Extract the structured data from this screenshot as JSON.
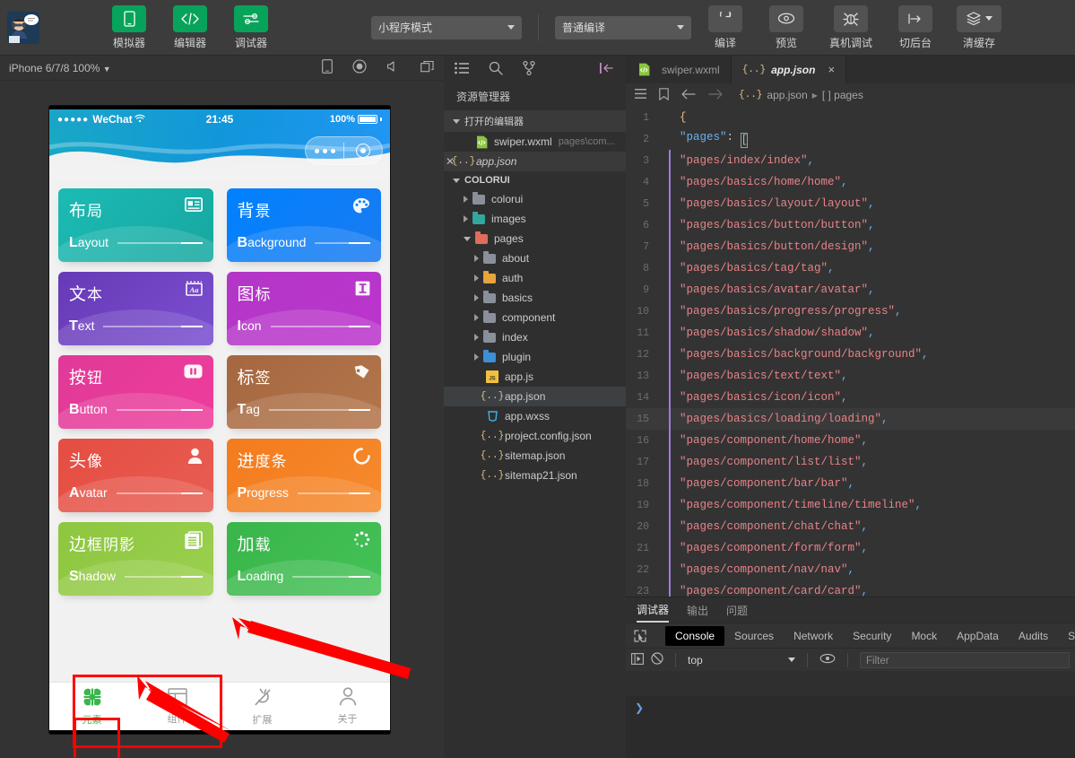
{
  "toolbar": {
    "avatar_name": "user-avatar",
    "buttons": [
      {
        "label": "模拟器",
        "icon": "phone-icon",
        "style": "green"
      },
      {
        "label": "编辑器",
        "icon": "code-icon",
        "style": "green"
      },
      {
        "label": "调试器",
        "icon": "sliders-icon",
        "style": "green"
      }
    ],
    "mode_select": "小程序模式",
    "compile_select": "普通编译",
    "actions": [
      {
        "label": "编译",
        "icon": "refresh-icon"
      },
      {
        "label": "预览",
        "icon": "eye-icon"
      },
      {
        "label": "真机调试",
        "icon": "bug-icon"
      },
      {
        "label": "切后台",
        "icon": "background-icon"
      },
      {
        "label": "清缓存",
        "icon": "layers-icon"
      }
    ]
  },
  "simulator": {
    "device": "iPhone 6/7/8 100%",
    "bar_icons": [
      "rotate-icon",
      "record-icon",
      "sound-icon",
      "windows-icon"
    ],
    "status": {
      "carrier": "WeChat",
      "dots": "●●●●●",
      "time": "21:45",
      "battery": "100%"
    },
    "cards": [
      {
        "cn": "布局",
        "cn_first": "布",
        "en": "Layout",
        "en_first": "L",
        "icon": "id-card-icon",
        "c1": "#1cbbb4",
        "c2": "#16a7a0"
      },
      {
        "cn": "背景",
        "cn_first": "背",
        "en": "Background",
        "en_first": "B",
        "icon": "palette-icon",
        "c1": "#0081ff",
        "c2": "#1a7bf0"
      },
      {
        "cn": "文本",
        "cn_first": "文",
        "en": "Text",
        "en_first": "T",
        "icon": "aa-icon",
        "c1": "#6739b6",
        "c2": "#7a4fd0"
      },
      {
        "cn": "图标",
        "cn_first": "图",
        "en": "Icon",
        "en_first": "I",
        "icon": "letter-i-icon",
        "c1": "#b336c7",
        "c2": "#bb35cc"
      },
      {
        "cn": "按钮",
        "cn_first": "按",
        "en": "Button",
        "en_first": "B",
        "icon": "pause-icon",
        "c1": "#e03997",
        "c2": "#ef3d9c"
      },
      {
        "cn": "标签",
        "cn_first": "标",
        "en": "Tag",
        "en_first": "T",
        "icon": "tag-icon",
        "c1": "#a5673f",
        "c2": "#b3764c"
      },
      {
        "cn": "头像",
        "cn_first": "头",
        "en": "Avatar",
        "en_first": "A",
        "icon": "person-icon",
        "c1": "#e54d42",
        "c2": "#e85d52"
      },
      {
        "cn": "进度条",
        "cn_first": "进",
        "en": "Progress",
        "en_first": "P",
        "icon": "spinner-icon",
        "c1": "#f37b1d",
        "c2": "#f68b2e"
      },
      {
        "cn": "边框阴影",
        "cn_first": "边",
        "en": "Shadow",
        "en_first": "S",
        "icon": "pages-icon",
        "c1": "#8dc63f",
        "c2": "#9bd04f"
      },
      {
        "cn": "加载",
        "cn_first": "加",
        "en": "Loading",
        "en_first": "L",
        "icon": "loading-icon",
        "c1": "#39b54a",
        "c2": "#45c257"
      }
    ],
    "tabbar": [
      {
        "label": "元素",
        "icon": "flower-icon",
        "active": true
      },
      {
        "label": "组件",
        "icon": "layout-icon",
        "active": false
      },
      {
        "label": "扩展",
        "icon": "plug-icon",
        "active": false
      },
      {
        "label": "关于",
        "icon": "person-icon",
        "active": false
      }
    ]
  },
  "explorer": {
    "top_icons": [
      "files-icon",
      "search-icon",
      "source-control-icon"
    ],
    "collapse_icon": "collapse-panel-icon",
    "title": "资源管理器",
    "open_editors_label": "打开的编辑器",
    "open_editors": [
      {
        "name": "swiper.wxml",
        "path": "pages\\com...",
        "icon": "wxml-file-icon"
      },
      {
        "name": "app.json",
        "path": "",
        "icon": "json-file-icon",
        "active": true
      }
    ],
    "project_label": "COLORUI",
    "tree": [
      {
        "name": "colorui",
        "type": "folder",
        "depth": 1,
        "color": "grey",
        "arrow": true
      },
      {
        "name": "images",
        "type": "folder",
        "depth": 1,
        "color": "teal",
        "arrow": true
      },
      {
        "name": "pages",
        "type": "folder",
        "depth": 1,
        "color": "red",
        "arrow": true,
        "open": true
      },
      {
        "name": "about",
        "type": "folder",
        "depth": 2,
        "color": "grey",
        "arrow": true
      },
      {
        "name": "auth",
        "type": "folder",
        "depth": 2,
        "color": "orange",
        "arrow": true
      },
      {
        "name": "basics",
        "type": "folder",
        "depth": 2,
        "color": "grey",
        "arrow": true
      },
      {
        "name": "component",
        "type": "folder",
        "depth": 2,
        "color": "grey",
        "arrow": true
      },
      {
        "name": "index",
        "type": "folder",
        "depth": 2,
        "color": "grey",
        "arrow": true
      },
      {
        "name": "plugin",
        "type": "folder",
        "depth": 2,
        "color": "blue",
        "arrow": true
      },
      {
        "name": "app.js",
        "type": "js",
        "depth": 2
      },
      {
        "name": "app.json",
        "type": "json",
        "depth": 2,
        "selected": true
      },
      {
        "name": "app.wxss",
        "type": "wxss",
        "depth": 2
      },
      {
        "name": "project.config.json",
        "type": "json",
        "depth": 2
      },
      {
        "name": "sitemap.json",
        "type": "json",
        "depth": 2
      },
      {
        "name": "sitemap21.json",
        "type": "json",
        "depth": 2
      }
    ]
  },
  "editor": {
    "tabs": [
      {
        "label": "swiper.wxml",
        "icon": "wxml-file-icon",
        "active": false
      },
      {
        "label": "app.json",
        "icon": "json-file-icon",
        "active": true,
        "close": "×"
      }
    ],
    "breadcrumb_icons": [
      "outline-icon",
      "bookmark-icon",
      "back-arrow-icon",
      "forward-arrow-icon"
    ],
    "breadcrumb": "app.json ▸ [ ] pages",
    "breadcrumb_file": "app.json",
    "breadcrumb_sep": "▸",
    "breadcrumb_node": "[ ] pages",
    "lines": [
      {
        "n": 1,
        "text": "{",
        "kind": "brace",
        "guide": false
      },
      {
        "n": 2,
        "text": "\"pages\": [",
        "kind": "keyline",
        "guide": false
      },
      {
        "n": 3,
        "text": "\"pages/index/index\",",
        "kind": "str",
        "guide": true
      },
      {
        "n": 4,
        "text": "\"pages/basics/home/home\",",
        "kind": "str",
        "guide": true
      },
      {
        "n": 5,
        "text": "\"pages/basics/layout/layout\",",
        "kind": "str",
        "guide": true
      },
      {
        "n": 6,
        "text": "\"pages/basics/button/button\",",
        "kind": "str",
        "guide": true
      },
      {
        "n": 7,
        "text": "\"pages/basics/button/design\",",
        "kind": "str",
        "guide": true
      },
      {
        "n": 8,
        "text": "\"pages/basics/tag/tag\",",
        "kind": "str",
        "guide": true
      },
      {
        "n": 9,
        "text": "\"pages/basics/avatar/avatar\",",
        "kind": "str",
        "guide": true
      },
      {
        "n": 10,
        "text": "\"pages/basics/progress/progress\",",
        "kind": "str",
        "guide": true
      },
      {
        "n": 11,
        "text": "\"pages/basics/shadow/shadow\",",
        "kind": "str",
        "guide": true
      },
      {
        "n": 12,
        "text": "\"pages/basics/background/background\",",
        "kind": "str",
        "guide": true
      },
      {
        "n": 13,
        "text": "\"pages/basics/text/text\",",
        "kind": "str",
        "guide": true
      },
      {
        "n": 14,
        "text": "\"pages/basics/icon/icon\",",
        "kind": "str",
        "guide": true
      },
      {
        "n": 15,
        "text": "\"pages/basics/loading/loading\",",
        "kind": "str",
        "guide": true,
        "highlight": true
      },
      {
        "n": 16,
        "text": "\"pages/component/home/home\",",
        "kind": "str",
        "guide": true
      },
      {
        "n": 17,
        "text": "\"pages/component/list/list\",",
        "kind": "str",
        "guide": true
      },
      {
        "n": 18,
        "text": "\"pages/component/bar/bar\",",
        "kind": "str",
        "guide": true
      },
      {
        "n": 19,
        "text": "\"pages/component/timeline/timeline\",",
        "kind": "str",
        "guide": true
      },
      {
        "n": 20,
        "text": "\"pages/component/chat/chat\",",
        "kind": "str",
        "guide": true
      },
      {
        "n": 21,
        "text": "\"pages/component/form/form\",",
        "kind": "str",
        "guide": true
      },
      {
        "n": 22,
        "text": "\"pages/component/nav/nav\",",
        "kind": "str",
        "guide": true
      },
      {
        "n": 23,
        "text": "\"pages/component/card/card\",",
        "kind": "str",
        "guide": true
      }
    ]
  },
  "debugger": {
    "panel_tabs": [
      {
        "label": "调试器",
        "active": true
      },
      {
        "label": "输出",
        "active": false
      },
      {
        "label": "问题",
        "active": false
      }
    ],
    "devtools_tabs": [
      {
        "label": "Console",
        "active": true
      },
      {
        "label": "Sources",
        "active": false
      },
      {
        "label": "Network",
        "active": false
      },
      {
        "label": "Security",
        "active": false
      },
      {
        "label": "Mock",
        "active": false
      },
      {
        "label": "AppData",
        "active": false
      },
      {
        "label": "Audits",
        "active": false
      },
      {
        "label": "S",
        "active": false
      }
    ],
    "inspect_icon": "inspect-icon",
    "context": "top",
    "clear_icon": "clear-console-icon",
    "eye_icon": "eye-icon",
    "filter_placeholder": "Filter",
    "prompt": "❯"
  },
  "annotations": {
    "highlight_color": "#ff0000",
    "boxes": [
      "shadow-card-highlight",
      "tab-element-highlight"
    ],
    "arrows": [
      "arrow-to-shadow-card",
      "arrow-to-element-tab"
    ]
  }
}
